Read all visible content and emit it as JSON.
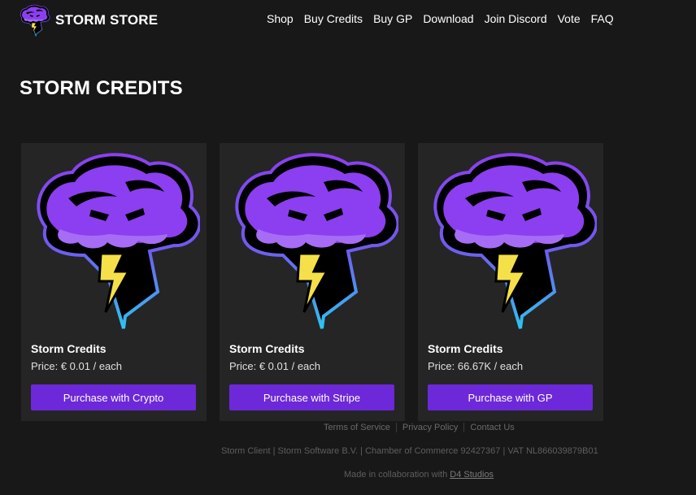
{
  "brand": {
    "name": "STORM STORE",
    "logo_icon": "storm-cloud-icon"
  },
  "nav": [
    {
      "label": "Shop"
    },
    {
      "label": "Buy Credits"
    },
    {
      "label": "Buy GP"
    },
    {
      "label": "Download"
    },
    {
      "label": "Join Discord"
    },
    {
      "label": "Vote"
    },
    {
      "label": "FAQ"
    }
  ],
  "page": {
    "title": "STORM CREDITS"
  },
  "products": [
    {
      "title": "Storm Credits",
      "price": "Price: € 0.01 / each",
      "button": "Purchase with Crypto",
      "image_icon": "storm-cloud-icon"
    },
    {
      "title": "Storm Credits",
      "price": "Price: € 0.01 / each",
      "button": "Purchase with Stripe",
      "image_icon": "storm-cloud-icon"
    },
    {
      "title": "Storm Credits",
      "price": "Price: 66.67K / each",
      "button": "Purchase with GP",
      "image_icon": "storm-cloud-icon"
    }
  ],
  "footer": {
    "links": [
      {
        "label": "Terms of Service"
      },
      {
        "label": "Privacy Policy"
      },
      {
        "label": "Contact Us"
      }
    ],
    "info": "Storm Client | Storm Software B.V. | Chamber of Commerce 92427367 | VAT NL866039879B01",
    "credit_prefix": "Made in collaboration with",
    "credit_link": "D4 Studios"
  },
  "colors": {
    "background": "#181818",
    "card": "#252525",
    "button": "#6d28d9",
    "cloud": "#8b3ff0",
    "cloud_outline": "#2ec4f0",
    "bolt": "#f5e04a"
  }
}
